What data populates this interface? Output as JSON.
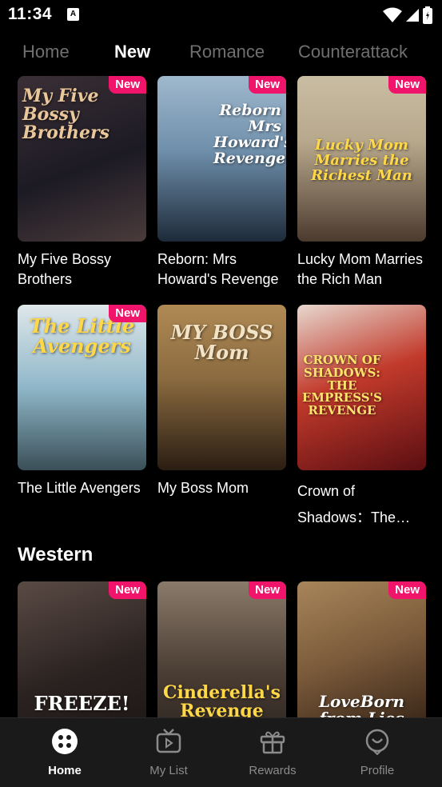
{
  "status_bar": {
    "time": "11:34",
    "app_icon_letter": "A",
    "icons": [
      "wifi-icon",
      "signal-icon",
      "battery-icon"
    ]
  },
  "tabs": [
    {
      "label": "Home",
      "active": false
    },
    {
      "label": "New",
      "active": true
    },
    {
      "label": "Romance",
      "active": false
    },
    {
      "label": "Counterattack",
      "active": false
    }
  ],
  "badge_label": "New",
  "new_section": {
    "cards": [
      {
        "title": "My Five Bossy Brothers",
        "poster_text": "My Five Bossy Brothers",
        "badge": true,
        "colors": [
          "#1c1a24",
          "#4a3b3b"
        ],
        "accent": "#e9c79a"
      },
      {
        "title": "Reborn: Mrs Howard's Revenge",
        "poster_text": "Reborn Mrs Howard's Revenge",
        "badge": true,
        "colors": [
          "#6f8fab",
          "#1d2a3a"
        ],
        "accent": "#ffffff"
      },
      {
        "title": "Lucky Mom Marries the Rich Man",
        "poster_text": "Lucky Mom Marries the Richest Man",
        "badge": true,
        "colors": [
          "#b7a88c",
          "#4b3a2e"
        ],
        "accent": "#ffd84a"
      },
      {
        "title": "The Little Avengers",
        "poster_text": "The Little Avengers",
        "badge": true,
        "colors": [
          "#8fb7c9",
          "#3a4f57"
        ],
        "accent": "#ffd84a"
      },
      {
        "title": "My Boss Mom",
        "poster_text": "MY BOSS Mom",
        "badge": false,
        "colors": [
          "#8a6a3f",
          "#2a1d12"
        ],
        "accent": "#f2e3c6"
      },
      {
        "title": "Crown of Shadows：The Empress's Revenge",
        "poster_text": "CROWN OF SHADOWS: THE EMPRESS'S REVENGE",
        "badge": false,
        "colors": [
          "#c23a2b",
          "#5a0e12"
        ],
        "accent": "#ffe36b"
      }
    ]
  },
  "western_section": {
    "heading": "Western",
    "cards": [
      {
        "title": "",
        "poster_text": "FREEZE!",
        "badge": true,
        "colors": [
          "#5a4a44",
          "#1a1514"
        ],
        "accent": "#ffffff"
      },
      {
        "title": "",
        "poster_text": "Cinderella's Revenge",
        "badge": true,
        "colors": [
          "#8a7a6a",
          "#2a2320"
        ],
        "accent": "#ffd84a"
      },
      {
        "title": "",
        "poster_text": "LoveBorn from Lies",
        "badge": true,
        "colors": [
          "#7a5a3a",
          "#2a1a10"
        ],
        "accent": "#ffffff"
      }
    ]
  },
  "bottom_nav": [
    {
      "label": "Home",
      "icon": "home-dots-icon",
      "active": true
    },
    {
      "label": "My List",
      "icon": "tv-icon",
      "active": false
    },
    {
      "label": "Rewards",
      "icon": "gift-icon",
      "active": false
    },
    {
      "label": "Profile",
      "icon": "profile-face-icon",
      "active": false
    }
  ]
}
